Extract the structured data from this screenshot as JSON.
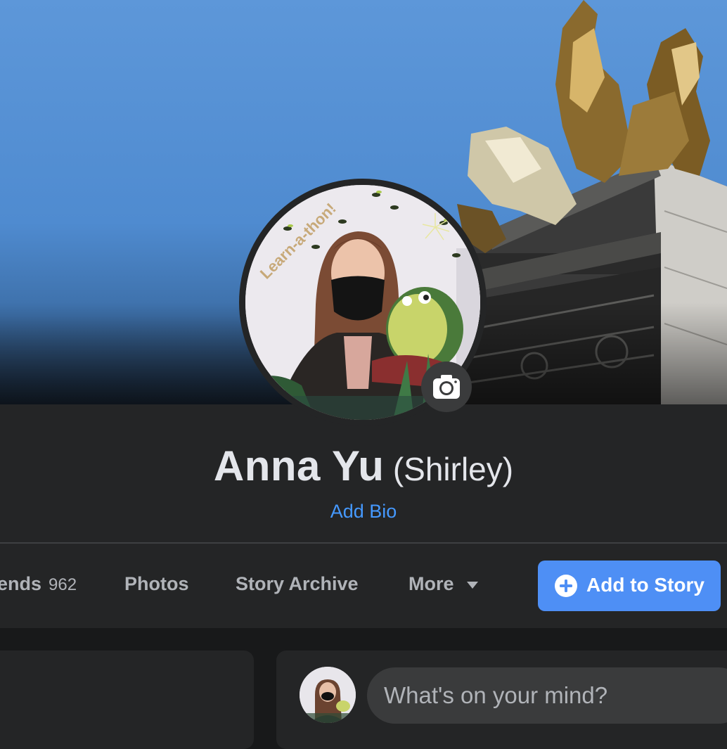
{
  "profile": {
    "name": "Anna Yu",
    "alternate_name": "(Shirley)",
    "add_bio_label": "Add Bio",
    "frame_text": "Learn-a-thon!"
  },
  "tabs": [
    {
      "label": "ends",
      "count": "962"
    },
    {
      "label": "Photos"
    },
    {
      "label": "Story Archive"
    },
    {
      "label": "More"
    }
  ],
  "actions": {
    "add_to_story_label": "Add to Story"
  },
  "composer": {
    "placeholder": "What's on your mind?"
  },
  "icons": [
    "camera-icon",
    "plus-circle-icon",
    "caret-down-icon"
  ],
  "colors": {
    "accent": "#4e8ff5",
    "link": "#4599ff",
    "panel": "#242526",
    "background": "#18191a",
    "text_primary": "#e4e6eb",
    "text_secondary": "#b0b3b8"
  }
}
